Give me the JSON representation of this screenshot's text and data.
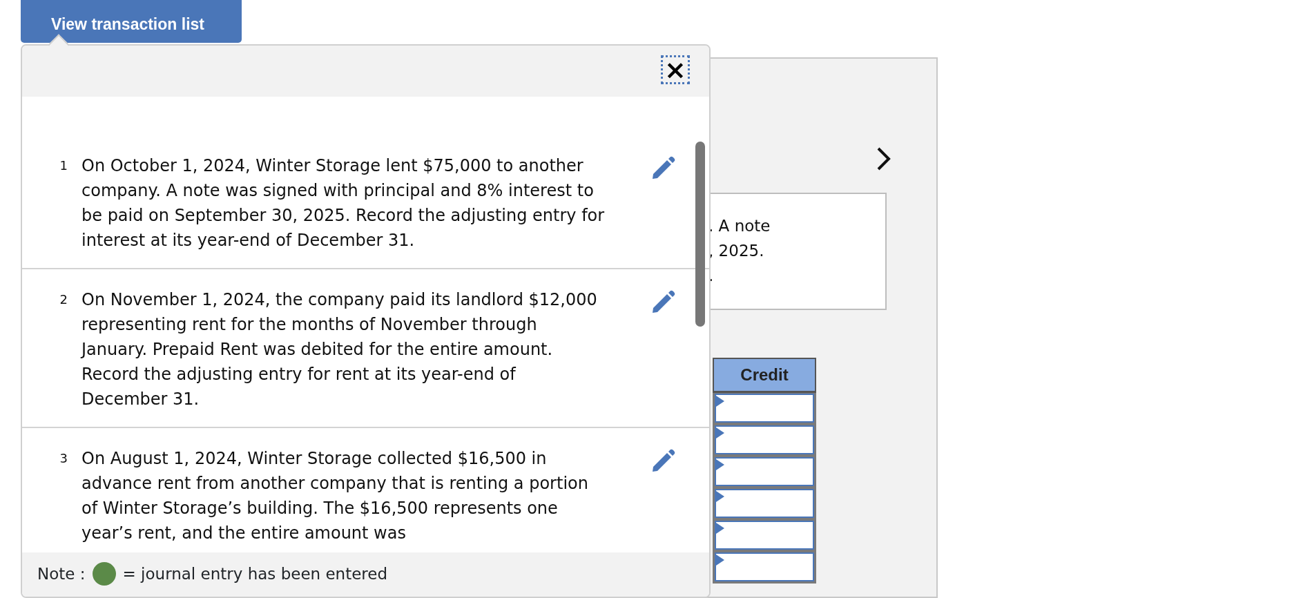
{
  "view_button": {
    "label": "View transaction list"
  },
  "popup": {
    "close": {
      "label": "×"
    },
    "transactions": [
      {
        "number": "1",
        "text": "On October 1, 2024, Winter Storage lent $75,000 to another company. A note was signed with principal and 8% interest to be paid on September 30, 2025. Record the adjusting entry for interest at its year-end of December 31."
      },
      {
        "number": "2",
        "text": "On November 1, 2024, the company paid its landlord $12,000 representing rent for the months of November through January. Prepaid Rent was debited for the entire amount. Record the adjusting entry for rent at its year-end of December 31."
      },
      {
        "number": "3",
        "text": "On August 1, 2024, Winter Storage collected $16,500 in advance rent from another company that is renting a portion of Winter Storage’s building. The $16,500 represents one year’s rent, and the entire amount was"
      }
    ],
    "note": {
      "label": "Note :",
      "legend": "= journal entry has been entered",
      "color": "#5b8a48"
    }
  },
  "panel": {
    "question_lines": [
      ". A note",
      ", 2025.",
      "."
    ],
    "credit_column": {
      "header": "Credit",
      "fields": [
        {
          "kind": "amount"
        },
        {
          "kind": "amount"
        },
        {
          "kind": "amount"
        },
        {
          "kind": "amount"
        },
        {
          "kind": "amount"
        },
        {
          "kind": "amount"
        }
      ]
    }
  }
}
